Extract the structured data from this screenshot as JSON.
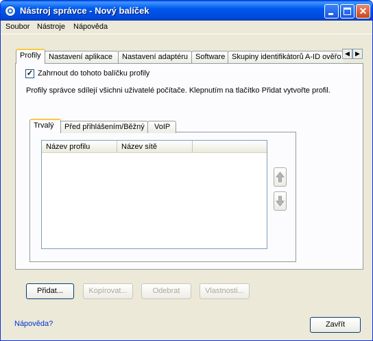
{
  "window": {
    "title": "Nástroj správce - Nový balíček"
  },
  "menu": {
    "items": [
      "Soubor",
      "Nástroje",
      "Nápověda"
    ]
  },
  "tabs": [
    "Profily",
    "Nastavení aplikace",
    "Nastavení adaptéru",
    "Software",
    "Skupiny identifikátorů A-ID ověřo"
  ],
  "profiles": {
    "include_label": "Zahrnout do tohoto balíčku profily",
    "include_checked": true,
    "info_text": "Profily správce sdílejí všichni uživatelé počítače. Klepnutím na tlačítko Přidat vytvořte profil.",
    "inner_tabs": [
      "Trvalý",
      "Před přihlášením/Běžný",
      "VoIP"
    ],
    "columns": [
      "Název profilu",
      "Název sítě",
      ""
    ],
    "rows": []
  },
  "buttons": {
    "add": "Přidat...",
    "copy": "Kopírovat...",
    "remove": "Odebrat",
    "properties": "Vlastnosti...",
    "close": "Zavřít"
  },
  "help_link": "Nápověda?",
  "icons": {
    "app": "wireless-tool-icon",
    "tab_scroll_left": "triangle-left-icon",
    "tab_scroll_right": "triangle-right-icon",
    "move_up": "arrow-up-icon",
    "move_down": "arrow-down-icon"
  }
}
